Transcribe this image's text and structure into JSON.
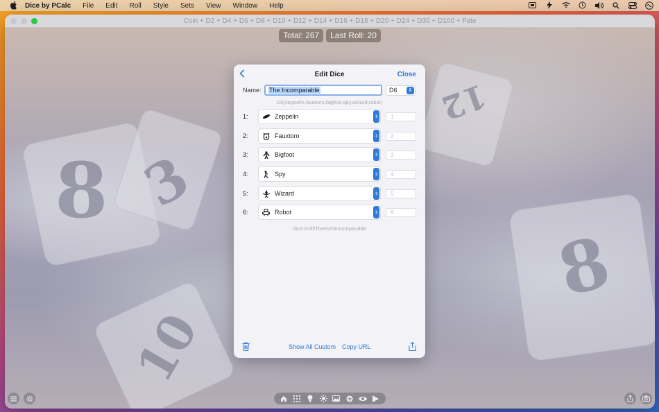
{
  "menubar": {
    "app_name": "Dice by PCalc",
    "items": [
      "File",
      "Edit",
      "Roll",
      "Style",
      "Sets",
      "View",
      "Window",
      "Help"
    ]
  },
  "window": {
    "title": "Coin + D2 + D4 + D6 + D8 + D10 + D12 + D14 + D16 + D18 + D20 + D24 + D30 + D100 + Fate"
  },
  "hud": {
    "total": "Total: 267",
    "last_roll": "Last Roll: 20"
  },
  "panel": {
    "title": "Edit Dice",
    "close_label": "Close",
    "name_label": "Name:",
    "name_value": "The Incomparable",
    "type_value": "D6",
    "hint": "D6(zeppelin,fauxtoro,bigfoot,spy,wizard,robot)",
    "faces": [
      {
        "num": "1:",
        "label": "Zeppelin",
        "icon": "zeppelin-icon",
        "placeholder": "1"
      },
      {
        "num": "2:",
        "label": "Fauxtoro",
        "icon": "fauxtoro-icon",
        "placeholder": "2"
      },
      {
        "num": "3:",
        "label": "Bigfoot",
        "icon": "bigfoot-icon",
        "placeholder": "3"
      },
      {
        "num": "4:",
        "label": "Spy",
        "icon": "spy-icon",
        "placeholder": "4"
      },
      {
        "num": "5:",
        "label": "Wizard",
        "icon": "wizard-icon",
        "placeholder": "5"
      },
      {
        "num": "6:",
        "label": "Robot",
        "icon": "robot-icon",
        "placeholder": "6"
      }
    ],
    "url": "dice://roll/The%20Incomparable",
    "show_all_label": "Show All Custom",
    "copy_url_label": "Copy URL"
  },
  "colors": {
    "accent": "#2f7bd6"
  }
}
